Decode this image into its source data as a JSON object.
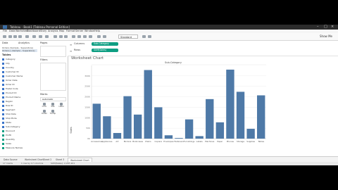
{
  "window": {
    "title": "Tableau - Book1 [Tableau Personal Edition]",
    "tab_label": "Tableau - Book1"
  },
  "menu": [
    "File",
    "Data",
    "Worksheet",
    "Dashboard",
    "Story",
    "Analysis",
    "Map",
    "Format",
    "Server",
    "Window",
    "Help"
  ],
  "toolbar": {
    "fit_dropdown": "Standard",
    "show_me": "Show Me"
  },
  "data_pane": {
    "tabs": [
      "Data",
      "Analytics"
    ],
    "sources": [
      "Orders (Sample - Superstore)",
      "Orders+ (Sample - Superstore)"
    ],
    "tables_header": "Tables",
    "fields": [
      "Category",
      "City",
      "Country",
      "Customer ID",
      "Customer Name",
      "Order Date",
      "Order ID",
      "Postal Code",
      "Product ID",
      "Product Name",
      "Region",
      "Row ID",
      "Segment",
      "Ship Date",
      "Ship Mode",
      "State",
      "Sub-Category",
      "Discount",
      "Profit",
      "Quantity",
      "Sales",
      "Measure Names"
    ]
  },
  "cards": {
    "pages": "Pages",
    "filters": "Filters",
    "marks": "Marks",
    "mark_type": "Automatic",
    "mark_cells": [
      "Color",
      "Size",
      "Label",
      "Detail",
      "Tooltip"
    ]
  },
  "shelves": {
    "columns_label": "Columns",
    "rows_label": "Rows",
    "columns_pill": "Sub-Category",
    "rows_pill": "SUM(Sales)"
  },
  "sheet_title": "Worksheet Chart",
  "bar_color": "#4e79a7",
  "chart_data": {
    "type": "bar",
    "header": "Sub-Category",
    "categories": [
      "Accessories",
      "Appliances",
      "Art",
      "Binders",
      "Bookcases",
      "Chairs",
      "Copiers",
      "Envelopes",
      "Fasteners",
      "Furnishings",
      "Labels",
      "Machines",
      "Paper",
      "Phones",
      "Storage",
      "Supplies",
      "Tables"
    ],
    "values": [
      167,
      107,
      27,
      203,
      115,
      328,
      150,
      16,
      3,
      92,
      12,
      189,
      78,
      330,
      224,
      47,
      207
    ],
    "yticks": [
      "0K",
      "50K",
      "100K",
      "150K",
      "200K",
      "250K",
      "300K"
    ],
    "ylabel": "Sales",
    "ylim": [
      0,
      350
    ]
  },
  "sheet_tabs": [
    "Data Source",
    "Worksheet Chart",
    "Sheet 2",
    "Sheet 3",
    "Worksheet Chart"
  ],
  "status": [
    "17 marks",
    "1 row by 17 columns",
    "SUM(Sales): 2,297,201"
  ]
}
